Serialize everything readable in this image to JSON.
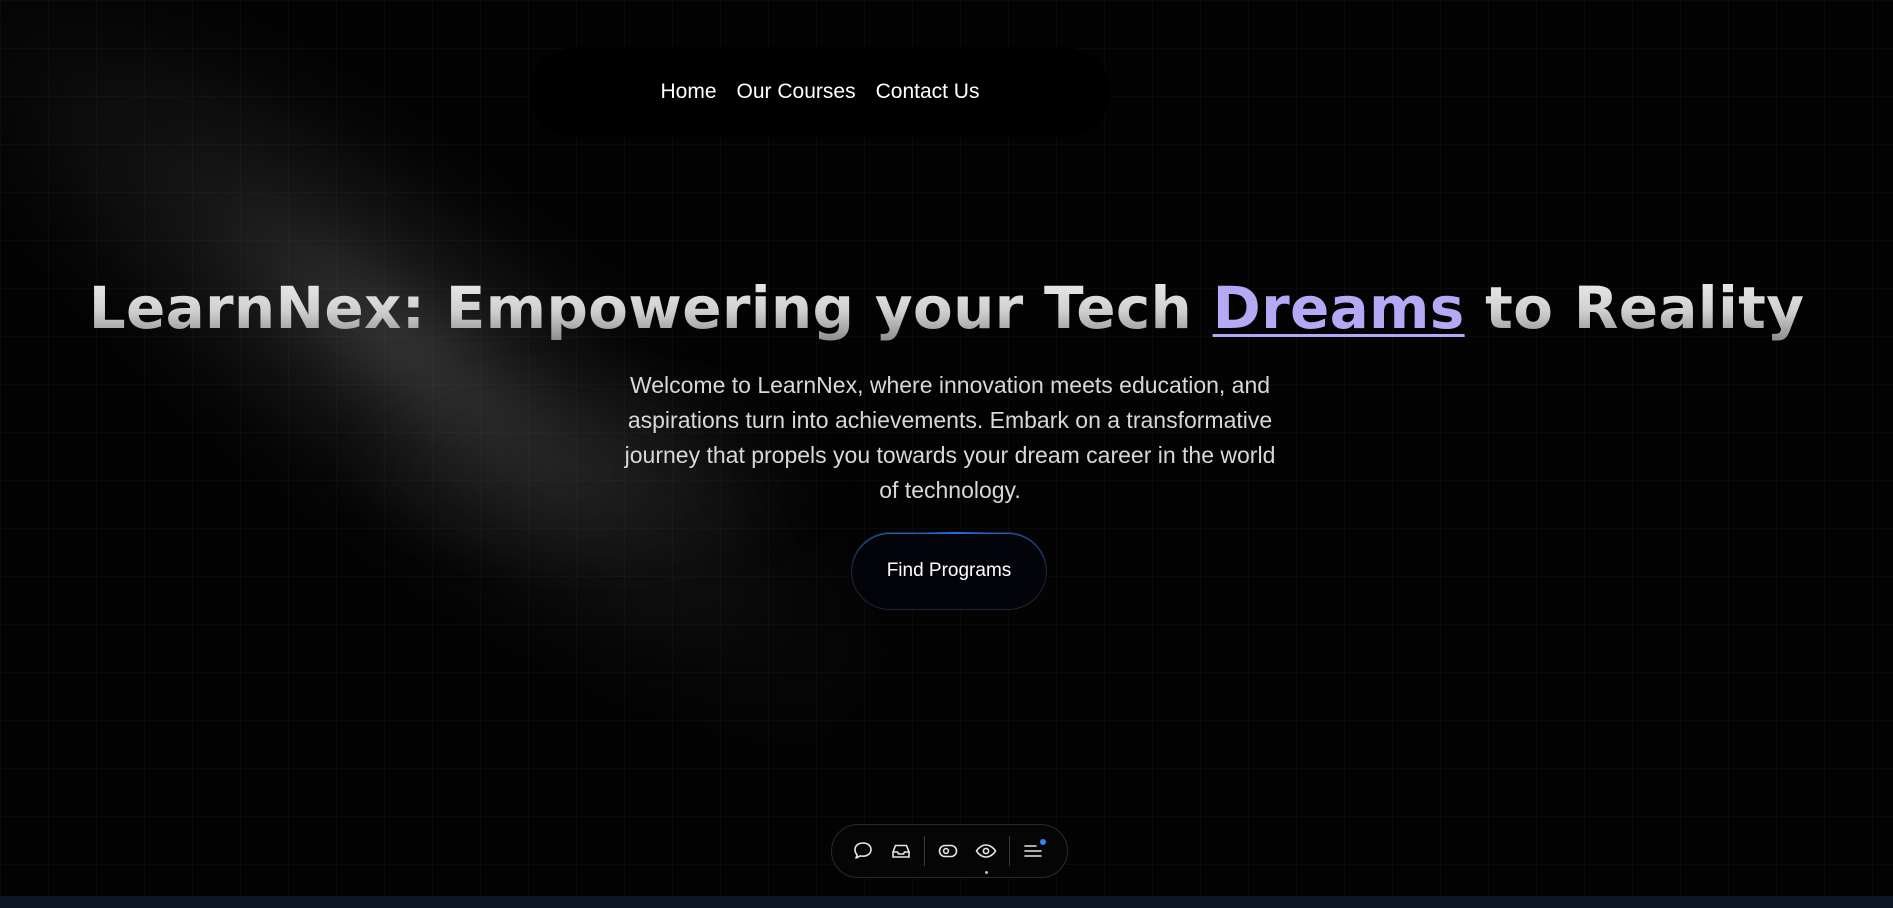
{
  "nav": {
    "links": [
      {
        "label": "Home"
      },
      {
        "label": "Our Courses"
      },
      {
        "label": "Contact Us"
      }
    ]
  },
  "hero": {
    "title_part1": "LearnNex: Empowering your Tech ",
    "title_accent": "Dreams",
    "title_part2": " to Reality",
    "subtitle": "Welcome to LearnNex, where innovation meets education, and aspirations turn into achievements. Embark on a transformative journey that propels you towards your dream career in the world of technology.",
    "cta_label": "Find Programs"
  },
  "toolbar": {
    "buttons": [
      {
        "icon": "comment-icon"
      },
      {
        "icon": "inbox-icon"
      },
      {
        "icon": "eye-toggle-icon"
      },
      {
        "icon": "eye-icon"
      },
      {
        "icon": "menu-icon"
      }
    ]
  },
  "colors": {
    "background": "#030303",
    "accent_purple": "#b7a8f5",
    "cta_glow_blue": "#1e6eff",
    "notify_blue": "#3b82f6",
    "bottom_strip": "#0c1626"
  }
}
